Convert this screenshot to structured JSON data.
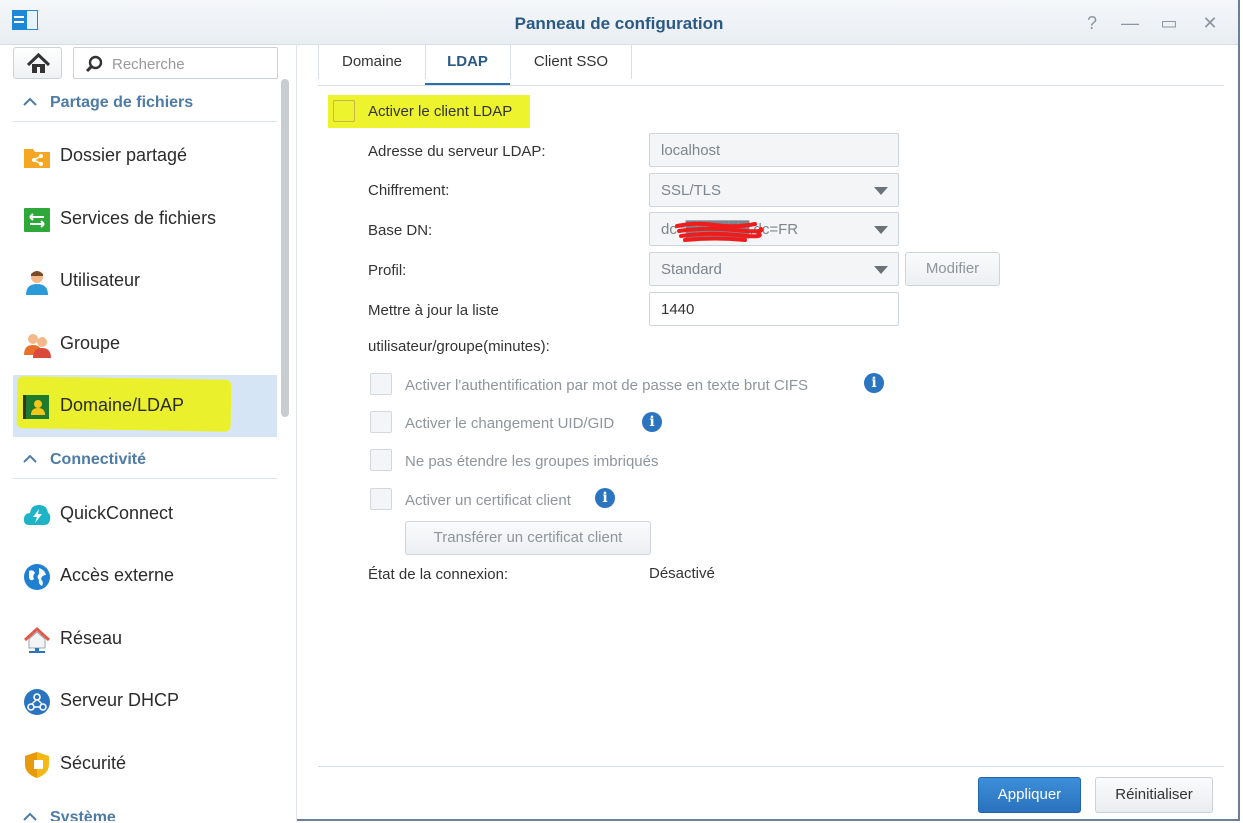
{
  "window": {
    "title": "Panneau de configuration",
    "controls": {
      "help": "?",
      "minimize": "—",
      "maximize": "▭",
      "close": "✕"
    }
  },
  "sidebar": {
    "search_placeholder": "Recherche",
    "sections": [
      {
        "label": "Partage de fichiers"
      },
      {
        "label": "Connectivité"
      },
      {
        "label": "Système"
      }
    ],
    "items": [
      {
        "label": "Dossier partagé",
        "icon": "shared-folder-icon"
      },
      {
        "label": "Services de fichiers",
        "icon": "file-services-icon"
      },
      {
        "label": "Utilisateur",
        "icon": "user-icon"
      },
      {
        "label": "Groupe",
        "icon": "group-icon"
      },
      {
        "label": "Domaine/LDAP",
        "icon": "domain-ldap-icon",
        "active": true
      },
      {
        "label": "QuickConnect",
        "icon": "quickconnect-icon"
      },
      {
        "label": "Accès externe",
        "icon": "external-access-icon"
      },
      {
        "label": "Réseau",
        "icon": "network-icon"
      },
      {
        "label": "Serveur DHCP",
        "icon": "dhcp-server-icon"
      },
      {
        "label": "Sécurité",
        "icon": "security-icon"
      }
    ]
  },
  "tabs": [
    {
      "label": "Domaine"
    },
    {
      "label": "LDAP",
      "active": true
    },
    {
      "label": "Client SSO"
    }
  ],
  "ldap": {
    "enable_label": "Activer le client LDAP",
    "server_label": "Adresse du serveur LDAP:",
    "server_placeholder": "localhost",
    "encryption_label": "Chiffrement:",
    "encryption_value": "SSL/TLS",
    "basedn_label": "Base DN:",
    "basedn_value": "dc=██████,dc=FR",
    "profile_label": "Profil:",
    "profile_value": "Standard",
    "modify_button": "Modifier",
    "update_label_1": "Mettre à jour la liste",
    "update_label_2": "utilisateur/groupe(minutes):",
    "update_value": "1440",
    "opt_cifs": "Activer l'authentification par mot de passe en texte brut CIFS",
    "opt_uid": "Activer le changement UID/GID",
    "opt_nested": "Ne pas étendre les groupes imbriqués",
    "opt_cert": "Activer un certificat client",
    "upload_cert_button": "Transférer un certificat client",
    "status_label": "État de la connexion:",
    "status_value": "Désactivé"
  },
  "footer": {
    "apply": "Appliquer",
    "reset": "Réinitialiser"
  },
  "colors": {
    "accent": "#2a72bd",
    "title": "#2a5a84",
    "section": "#4d7ba6",
    "active_bg": "#d5e5f6",
    "highlight": "#ecf21a"
  }
}
